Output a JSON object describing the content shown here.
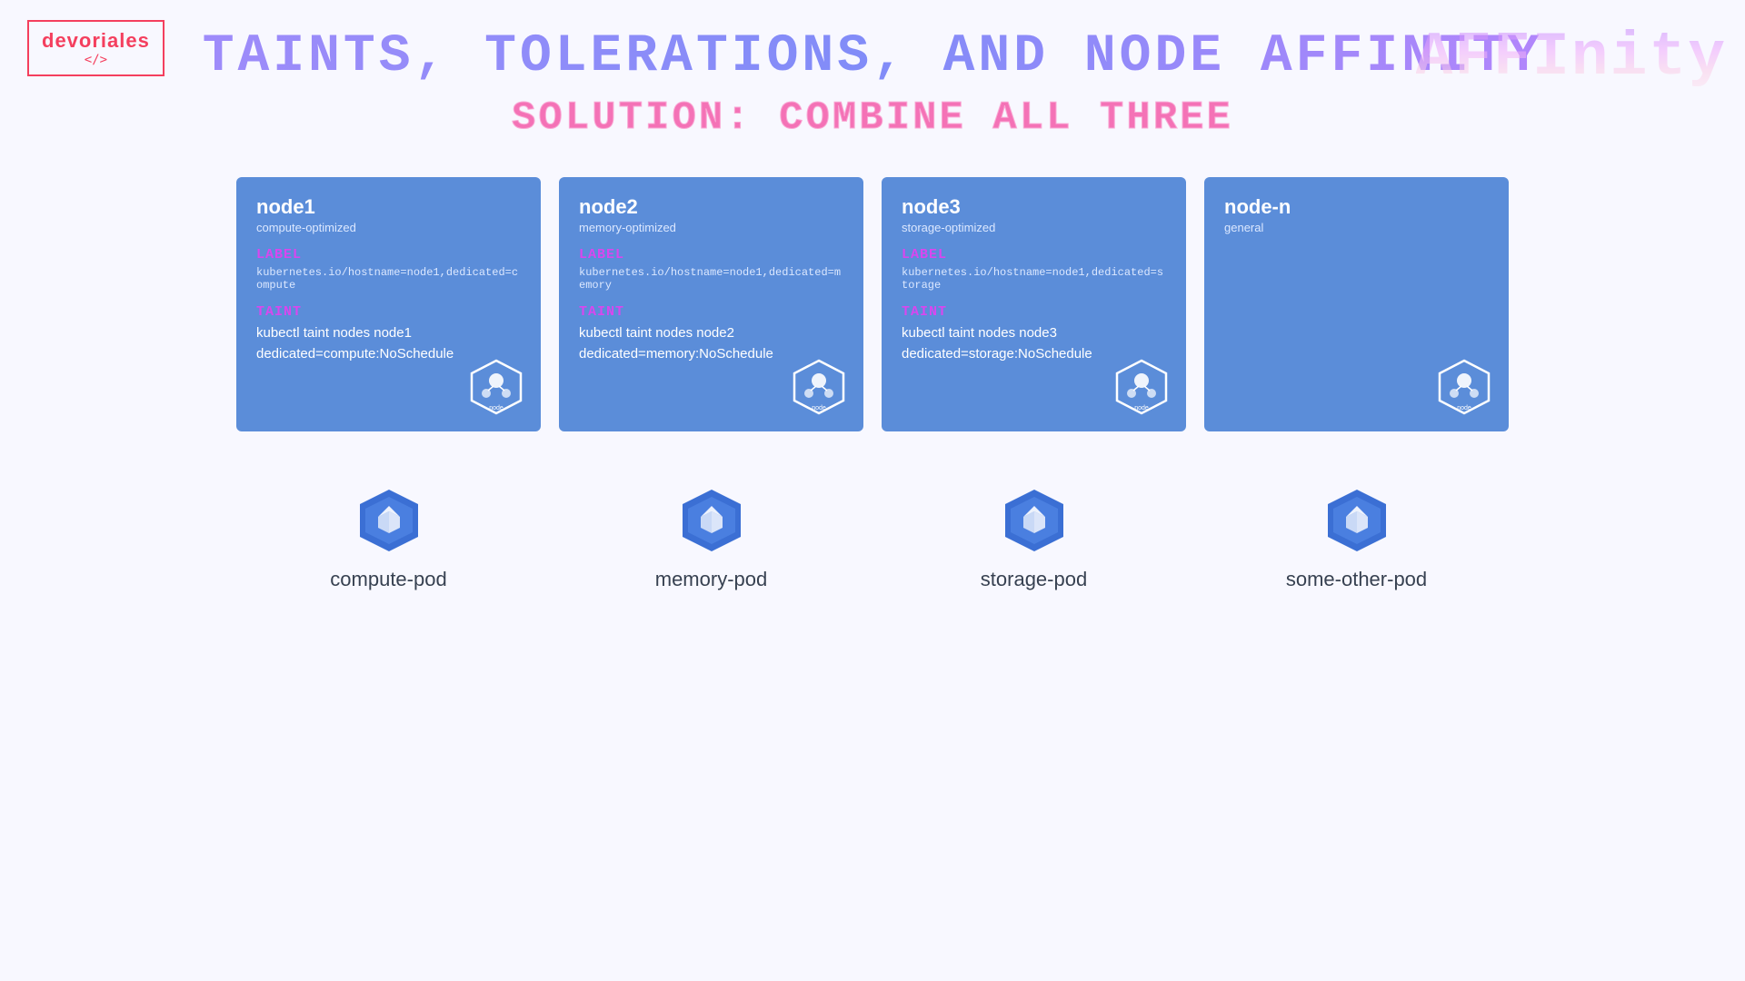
{
  "logo": {
    "text": "devoriales",
    "tag": "</>",
    "border_color": "#f43f5e"
  },
  "main_title": "TAINTS, TOLERATIONS, AND NODE AFFINITY",
  "subtitle": "SOLUTION: COMBINE ALL THREE",
  "nodes": [
    {
      "id": "node1",
      "name": "node1",
      "type": "compute-optimized",
      "label_heading": "LABEL",
      "label_value": "kubernetes.io/hostname=node1,dedicated=compute",
      "taint_heading": "TAINT",
      "taint_line1": "kubectl taint nodes node1",
      "taint_line2": "dedicated=compute:NoSchedule"
    },
    {
      "id": "node2",
      "name": "node2",
      "type": "memory-optimized",
      "label_heading": "LABEL",
      "label_value": "kubernetes.io/hostname=node1,dedicated=memory",
      "taint_heading": "TAINT",
      "taint_line1": "kubectl taint nodes node2",
      "taint_line2": "dedicated=memory:NoSchedule"
    },
    {
      "id": "node3",
      "name": "node3",
      "type": "storage-optimized",
      "label_heading": "LABEL",
      "label_value": "kubernetes.io/hostname=node1,dedicated=storage",
      "taint_heading": "TAINT",
      "taint_line1": "kubectl taint nodes node3",
      "taint_line2": "dedicated=storage:NoSchedule"
    },
    {
      "id": "node-n",
      "name": "node-n",
      "type": "general",
      "label_heading": "",
      "label_value": "",
      "taint_heading": "",
      "taint_line1": "",
      "taint_line2": ""
    }
  ],
  "pods": [
    {
      "id": "compute-pod",
      "name": "compute-pod"
    },
    {
      "id": "memory-pod",
      "name": "memory-pod"
    },
    {
      "id": "storage-pod",
      "name": "storage-pod"
    },
    {
      "id": "some-other-pod",
      "name": "some-other-pod"
    }
  ],
  "node_icon_label": "node"
}
